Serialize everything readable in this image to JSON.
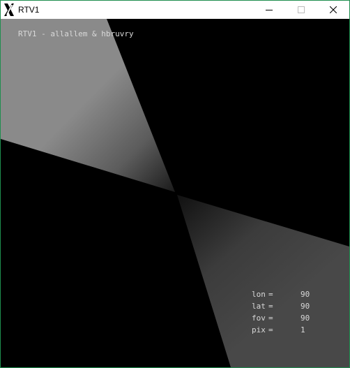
{
  "window": {
    "title": "RTV1",
    "app_icon": "x-logo-icon",
    "buttons": {
      "minimize_icon": "minimize-icon",
      "maximize_icon": "maximize-icon",
      "close_icon": "close-icon"
    }
  },
  "canvas": {
    "caption": "RTV1 - allallem & hbruvry",
    "readouts": [
      {
        "key": "lon",
        "eq": "=",
        "value": "90"
      },
      {
        "key": "lat",
        "eq": "=",
        "value": "90"
      },
      {
        "key": "fov",
        "eq": "=",
        "value": "90"
      },
      {
        "key": "pix",
        "eq": "=",
        "value": "1"
      }
    ]
  },
  "colors": {
    "window_border": "#1e8e4e",
    "canvas_background": "#000000",
    "overlay_text": "#d9d9d9"
  }
}
